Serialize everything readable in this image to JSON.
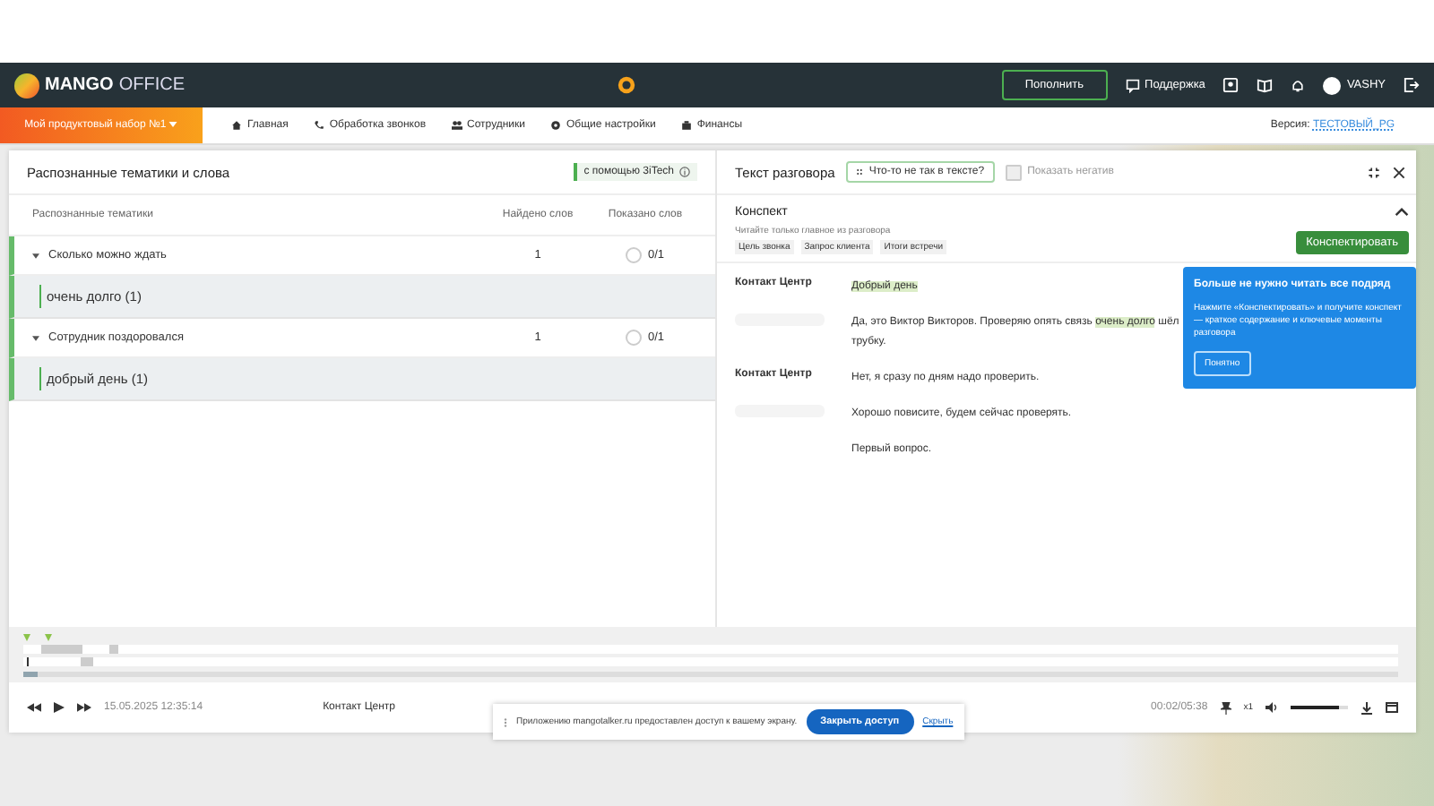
{
  "header": {
    "logo_bold": "MANGO",
    "logo_light": "OFFICE",
    "topup_button": "Пополнить",
    "support": "Поддержка",
    "user": "VASHY"
  },
  "nav": {
    "product_set": "Мой продуктовый набор №1",
    "items": [
      {
        "label": "Главная"
      },
      {
        "label": "Обработка звонков"
      },
      {
        "label": "Сотрудники"
      },
      {
        "label": "Общие настройки"
      },
      {
        "label": "Финансы"
      }
    ],
    "version_label": "Версия:",
    "version_value": "ТЕСТОВЫЙ_PG"
  },
  "left_panel": {
    "title": "Распознанные тематики и слова",
    "badge": "с помощью 3iTech",
    "columns": [
      "Распознанные тематики",
      "Найдено слов",
      "Показано слов"
    ],
    "topics": [
      {
        "name": "Сколько можно ждать",
        "found": "1",
        "shown": "0/1",
        "checked": false,
        "expanded": true,
        "words": [
          "очень долго (1)"
        ]
      },
      {
        "name": "Сотрудник поздоровался",
        "found": "1",
        "shown": "0/1",
        "checked": false,
        "expanded": true,
        "words": [
          "добрый день (1)"
        ]
      }
    ]
  },
  "right_panel": {
    "title": "Текст разговора",
    "report_button": "Что-то не так в тексте?",
    "show_negative": {
      "label": "Показать негатив",
      "checked": false
    },
    "summary": {
      "title": "Конспект",
      "expanded": true,
      "hint": "Читайте только главное из разговора",
      "tags": [
        "Цель звонка",
        "Запрос клиента",
        "Итоги встречи"
      ],
      "button": "Конспектировать"
    },
    "transcript": [
      {
        "kind": "operator",
        "speaker": "Контакт Центр",
        "lines": [
          [
            {
              "text": "Добрый день",
              "highlighted": true
            }
          ]
        ]
      },
      {
        "kind": "client",
        "lines": [
          [
            {
              "text": "Да, это Виктор Викторов. Проверяю опять связь ",
              "highlighted": false
            },
            {
              "text": "очень долго",
              "highlighted": true
            },
            {
              "text": " шёл",
              "highlighted": false
            }
          ],
          [
            {
              "text": "трубку.",
              "highlighted": false
            }
          ]
        ]
      },
      {
        "kind": "operator",
        "speaker": "Контакт Центр",
        "lines": [
          [
            {
              "text": "Нет, я сразу по дням надо проверить.",
              "highlighted": false
            }
          ]
        ]
      },
      {
        "kind": "client",
        "lines": [
          [
            {
              "text": "Хорошо повисите, будем сейчас проверять.",
              "highlighted": false
            }
          ]
        ]
      },
      {
        "kind": "client",
        "lines": [
          [
            {
              "text": "Первый вопрос.",
              "highlighted": false
            }
          ]
        ]
      }
    ]
  },
  "popover": {
    "title": "Больше не нужно читать все подряд",
    "body": "Нажмите «Конспектировать» и получите конспект — краткое содержание и ключевые моменты разговора",
    "button": "Понятно"
  },
  "player": {
    "progress": {
      "level": 0.01
    },
    "datetime": "15.05.2025 12:35:14",
    "speaker": "Контакт Центр",
    "time": "00:02/05:38",
    "speed": "x1",
    "volume": {
      "level": 0.85
    }
  },
  "toast": {
    "text": "Приложению mangotalker.ru предоставлен доступ к вашему экрану.",
    "button": "Закрыть доступ",
    "link": "Скрыть"
  }
}
